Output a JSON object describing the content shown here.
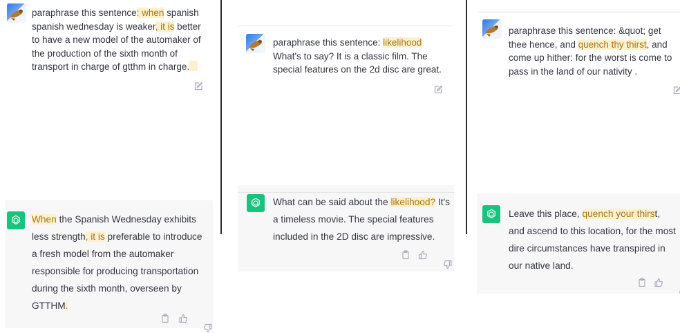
{
  "panels": [
    {
      "user": {
        "parts": [
          {
            "t": "paraphrase this sentence"
          },
          {
            "t": ": when",
            "hl": true
          },
          {
            "t": " spanish spanish wednesday is weaker"
          },
          {
            "t": ", it is",
            "hl": true
          },
          {
            "t": " better to have a new model of the automaker of the production of the sixth month of transport in charge of gtthm in charge."
          },
          {
            "t": "",
            "hl": true
          }
        ]
      },
      "bot": {
        "parts": [
          {
            "t": "When",
            "hl": true
          },
          {
            "t": " the Spanish Wednesday exhibits less strength"
          },
          {
            "t": ", it is",
            "hl": true
          },
          {
            "t": " preferable to introduce a fresh model from the automaker responsible for producing transportation during the sixth month, overseen by GTTHM"
          },
          {
            "t": ".",
            "hl": true
          }
        ]
      }
    },
    {
      "user": {
        "parts": [
          {
            "t": "paraphrase this sentence: "
          },
          {
            "t": "likelihood",
            "hl": true
          },
          {
            "t": " What's to say?  It is a classic film. The special features on the 2d disc are great."
          }
        ]
      },
      "bot": {
        "parts": [
          {
            "t": "What can be said about the "
          },
          {
            "t": "likelihood?",
            "hl": true
          },
          {
            "t": " It's a timeless movie. The special features included in the 2D disc are impressive."
          }
        ]
      }
    },
    {
      "user": {
        "parts": [
          {
            "t": "paraphrase this sentence: &quot; get thee hence, and "
          },
          {
            "t": "quench thy thirst",
            "hl": true
          },
          {
            "t": ", and come up hither: for the worst is come to pass in the land of our nativity ."
          }
        ]
      },
      "bot": {
        "parts": [
          {
            "t": "Leave this place, "
          },
          {
            "t": "quench your thirs",
            "hl": true
          },
          {
            "t": "t, and ascend to this location, for the most dire circumstances have transpired in our native land."
          }
        ]
      }
    }
  ]
}
